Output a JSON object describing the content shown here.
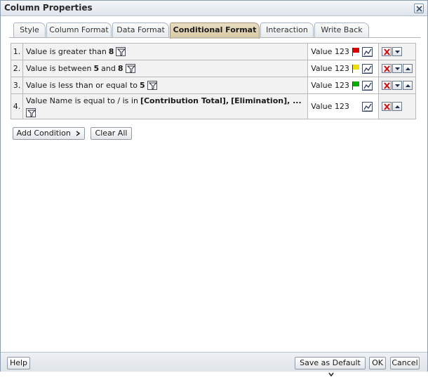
{
  "dialog": {
    "title": "Column Properties"
  },
  "tabs": [
    {
      "label": "Style"
    },
    {
      "label": "Column Format"
    },
    {
      "label": "Data Format"
    },
    {
      "label": "Conditional Format",
      "active": true
    },
    {
      "label": "Interaction"
    },
    {
      "label": "Write Back"
    }
  ],
  "conditions": [
    {
      "number": "1.",
      "text": "Value is greater than",
      "value": "8",
      "format_text": "Value 123",
      "flag_color": "#e00000"
    },
    {
      "number": "2.",
      "text": "Value is between",
      "value": "5",
      "connector": "and",
      "value2": "8",
      "format_text": "Value 123",
      "flag_color": "#f0e000"
    },
    {
      "number": "3.",
      "text": "Value is less than or equal to",
      "value": "5",
      "format_text": "Value 123",
      "flag_color": "#00b000"
    },
    {
      "number": "4.",
      "text": "Value Name is equal to / is in",
      "value": "[Contribution Total],",
      "value2": "[Elimination], ...",
      "format_text": "Value 123"
    }
  ],
  "actions": {
    "add_condition": "Add Condition",
    "clear_all": "Clear All"
  },
  "footer": {
    "help": "Help",
    "save_as_default": "Save as Default",
    "ok": "OK",
    "cancel": "Cancel"
  }
}
